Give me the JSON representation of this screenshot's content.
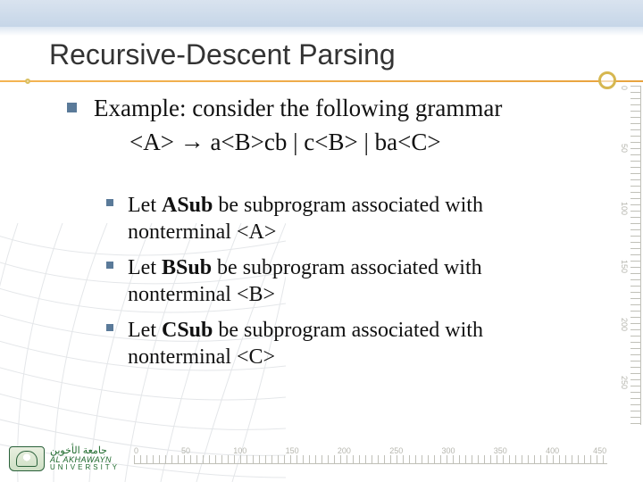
{
  "title": "Recursive-Descent Parsing",
  "intro": "Example: consider the following grammar",
  "grammar": {
    "lhs": "<A>",
    "arrow": "→",
    "rhs": "a<B>cb | c<B> | ba<C>"
  },
  "subs": [
    {
      "prefix": "Let ",
      "name": "ASub",
      "mid": " be subprogram associated with nonterminal ",
      "nt": "<A>"
    },
    {
      "prefix": "Let ",
      "name": "BSub",
      "mid": " be subprogram associated with nonterminal ",
      "nt": "<B>"
    },
    {
      "prefix": "Let ",
      "name": "CSub",
      "mid": " be subprogram associated with nonterminal ",
      "nt": "<C>"
    }
  ],
  "ruler_v": [
    "0",
    "50",
    "100",
    "150",
    "200",
    "250"
  ],
  "ruler_h": [
    "0",
    "50",
    "100",
    "150",
    "200",
    "250",
    "300",
    "350",
    "400",
    "450"
  ],
  "logo": {
    "arabic": "جامعة الأخوين",
    "en_top": "AL AKHAWAYN",
    "en_bot": "UNIVERSITY"
  }
}
